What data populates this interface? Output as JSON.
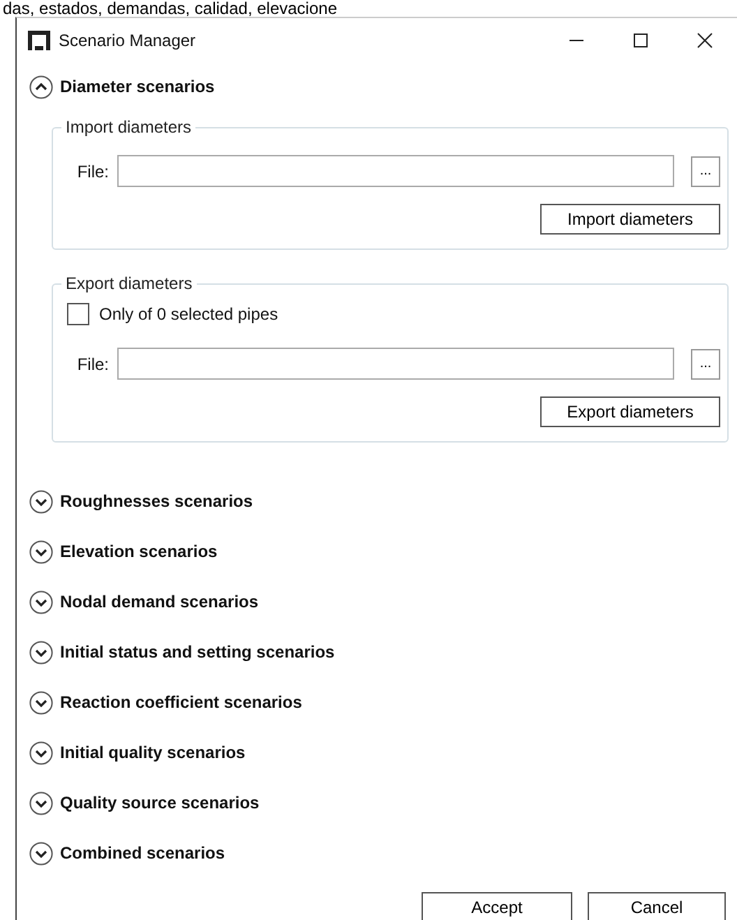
{
  "background_text": "das, estados, demandas, calidad, elevacione",
  "window": {
    "title": "Scenario Manager"
  },
  "sections": [
    {
      "title": "Diameter scenarios",
      "expanded": true,
      "groups": [
        {
          "kind": "import",
          "title": "Import diameters",
          "file_label": "File:",
          "browse": "...",
          "button": "Import diameters"
        },
        {
          "kind": "export",
          "title": "Export diameters",
          "checkbox": {
            "label": "Only of 0 selected pipes",
            "checked": false
          },
          "file_label": "File:",
          "browse": "...",
          "button": "Export diameters"
        }
      ]
    },
    {
      "title": "Roughnesses scenarios",
      "expanded": false
    },
    {
      "title": "Elevation scenarios",
      "expanded": false
    },
    {
      "title": "Nodal demand scenarios",
      "expanded": false
    },
    {
      "title": "Initial status and setting scenarios",
      "expanded": false
    },
    {
      "title": "Reaction coefficient scenarios",
      "expanded": false
    },
    {
      "title": "Initial quality scenarios",
      "expanded": false
    },
    {
      "title": "Quality source scenarios",
      "expanded": false
    },
    {
      "title": "Combined scenarios",
      "expanded": false
    }
  ],
  "buttons": [
    "Accept",
    "Cancel"
  ]
}
